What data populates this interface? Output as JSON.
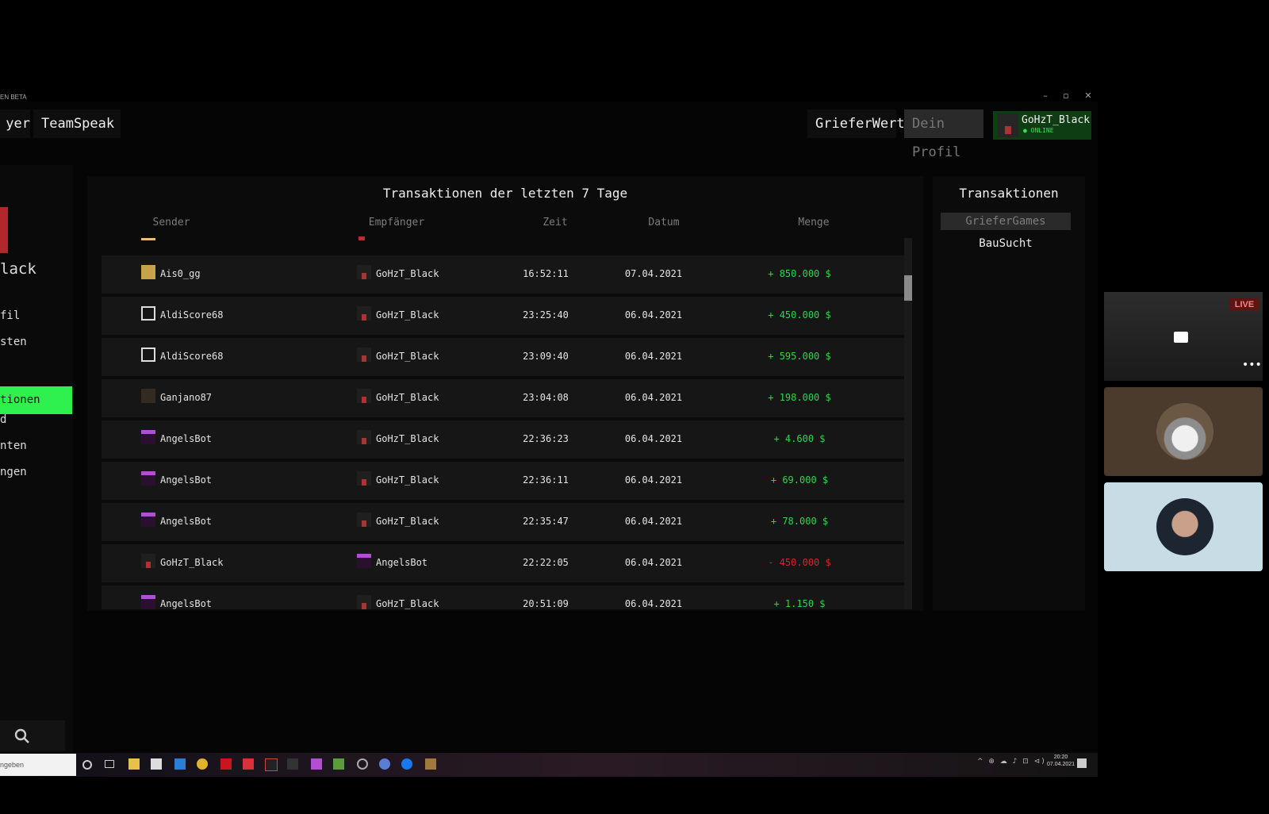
{
  "window": {
    "title": "EN BETA"
  },
  "nav": {
    "prev_label": "yer",
    "teamspeak_label": "TeamSpeak",
    "grieferwert_label": "GrieferWert",
    "profil_label": "Dein Profil",
    "user_name": "GoHzT_Black",
    "user_status": "● ONLINE"
  },
  "sidebar": {
    "name_fragment": "lack",
    "items": [
      "fil",
      "sten",
      "tionen",
      "d",
      "nten",
      "ngen"
    ],
    "active_index": 2
  },
  "transactions": {
    "title": "Transaktionen der letzten 7 Tage",
    "columns": [
      "Sender",
      "Empfänger",
      "Zeit",
      "Datum",
      "Menge"
    ],
    "rows": [
      {
        "sender": "Ais0_gg",
        "receiver": "GoHzT_Black",
        "time": "16:52:11",
        "date": "07.04.2021",
        "amount": "+ 850.000 $",
        "sign": "pos",
        "sender_icon": "gold-skin-icon",
        "receiver_icon": "gohzt-skin-icon"
      },
      {
        "sender": "AldiScore68",
        "receiver": "GoHzT_Black",
        "time": "23:25:40",
        "date": "06.04.2021",
        "amount": "+ 450.000 $",
        "sign": "pos",
        "sender_icon": "empty-skin-icon",
        "receiver_icon": "gohzt-skin-icon"
      },
      {
        "sender": "AldiScore68",
        "receiver": "GoHzT_Black",
        "time": "23:09:40",
        "date": "06.04.2021",
        "amount": "+ 595.000 $",
        "sign": "pos",
        "sender_icon": "empty-skin-icon",
        "receiver_icon": "gohzt-skin-icon"
      },
      {
        "sender": "Ganjano87",
        "receiver": "GoHzT_Black",
        "time": "23:04:08",
        "date": "06.04.2021",
        "amount": "+ 198.000 $",
        "sign": "pos",
        "sender_icon": "dark-skin-icon",
        "receiver_icon": "gohzt-skin-icon"
      },
      {
        "sender": "AngelsBot",
        "receiver": "GoHzT_Black",
        "time": "22:36:23",
        "date": "06.04.2021",
        "amount": "+ 4.600 $",
        "sign": "pos",
        "sender_icon": "angel-skin-icon",
        "receiver_icon": "gohzt-skin-icon"
      },
      {
        "sender": "AngelsBot",
        "receiver": "GoHzT_Black",
        "time": "22:36:11",
        "date": "06.04.2021",
        "amount": "+ 69.000 $",
        "sign": "pos",
        "sender_icon": "angel-skin-icon",
        "receiver_icon": "gohzt-skin-icon"
      },
      {
        "sender": "AngelsBot",
        "receiver": "GoHzT_Black",
        "time": "22:35:47",
        "date": "06.04.2021",
        "amount": "+ 78.000 $",
        "sign": "pos",
        "sender_icon": "angel-skin-icon",
        "receiver_icon": "gohzt-skin-icon"
      },
      {
        "sender": "GoHzT_Black",
        "receiver": "AngelsBot",
        "time": "22:22:05",
        "date": "06.04.2021",
        "amount": "- 450.000 $",
        "sign": "neg",
        "sender_icon": "gohzt-skin-icon",
        "receiver_icon": "angel-skin-icon"
      },
      {
        "sender": "AngelsBot",
        "receiver": "GoHzT_Black",
        "time": "20:51:09",
        "date": "06.04.2021",
        "amount": "+ 1.150 $",
        "sign": "pos",
        "sender_icon": "angel-skin-icon",
        "receiver_icon": "gohzt-skin-icon"
      }
    ]
  },
  "right_panel": {
    "title": "Transaktionen",
    "items": [
      "GrieferGames",
      "BauSucht"
    ]
  },
  "taskbar": {
    "search_placeholder": "ngeben",
    "time": "20:20",
    "date": "07.04.2021",
    "tray": "^ ⊕ ☁ ♪ ⊡ ⊲)"
  },
  "overlay": {
    "live_label": "LIVE",
    "more_label": "•••"
  },
  "colors": {
    "accent": "#2ef04f",
    "positive": "#34d24c",
    "negative": "#d02a2a",
    "user_panel": "#0e3d14"
  }
}
